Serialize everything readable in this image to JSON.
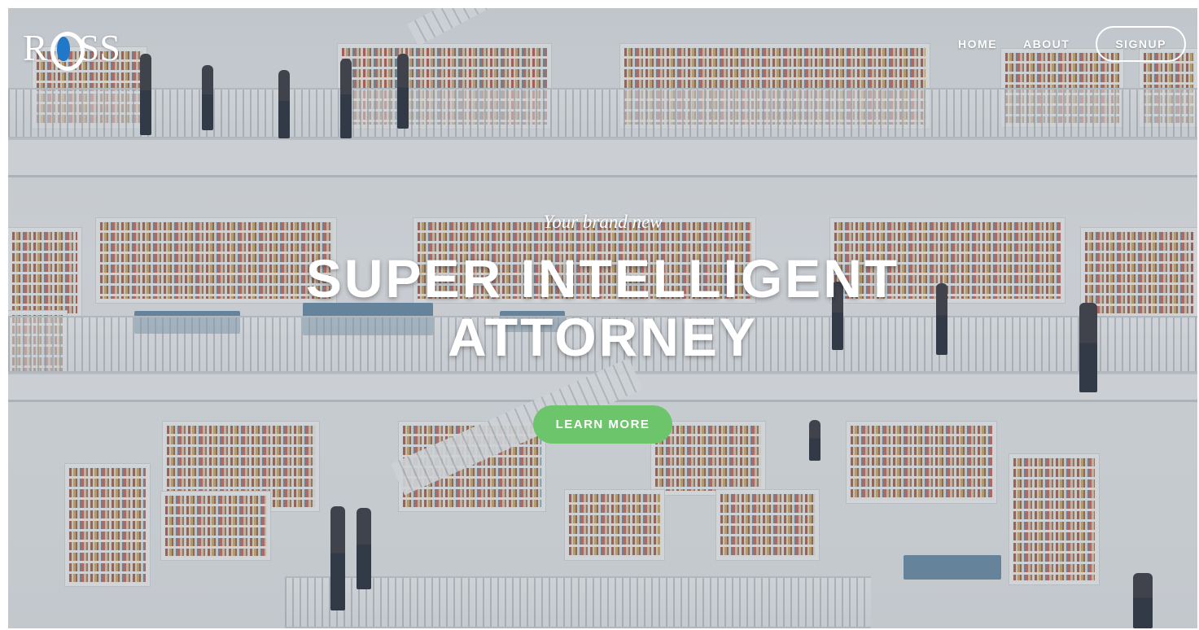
{
  "brand": {
    "logo_text_left": "R",
    "logo_text_right": "SS",
    "logo_name": "ross-logo"
  },
  "nav": {
    "home_label": "HOME",
    "about_label": "ABOUT",
    "signup_label": "SIGNUP"
  },
  "hero": {
    "tagline": "Your brand new",
    "headline_line1": "SUPER INTELLIGENT",
    "headline_line2": "ATTORNEY",
    "cta_label": "LEARN MORE"
  },
  "colors": {
    "cta": "#6cc56a",
    "logo_mark": "#1f78c8",
    "text": "#ffffff"
  },
  "background": {
    "scene": "library-interior"
  }
}
